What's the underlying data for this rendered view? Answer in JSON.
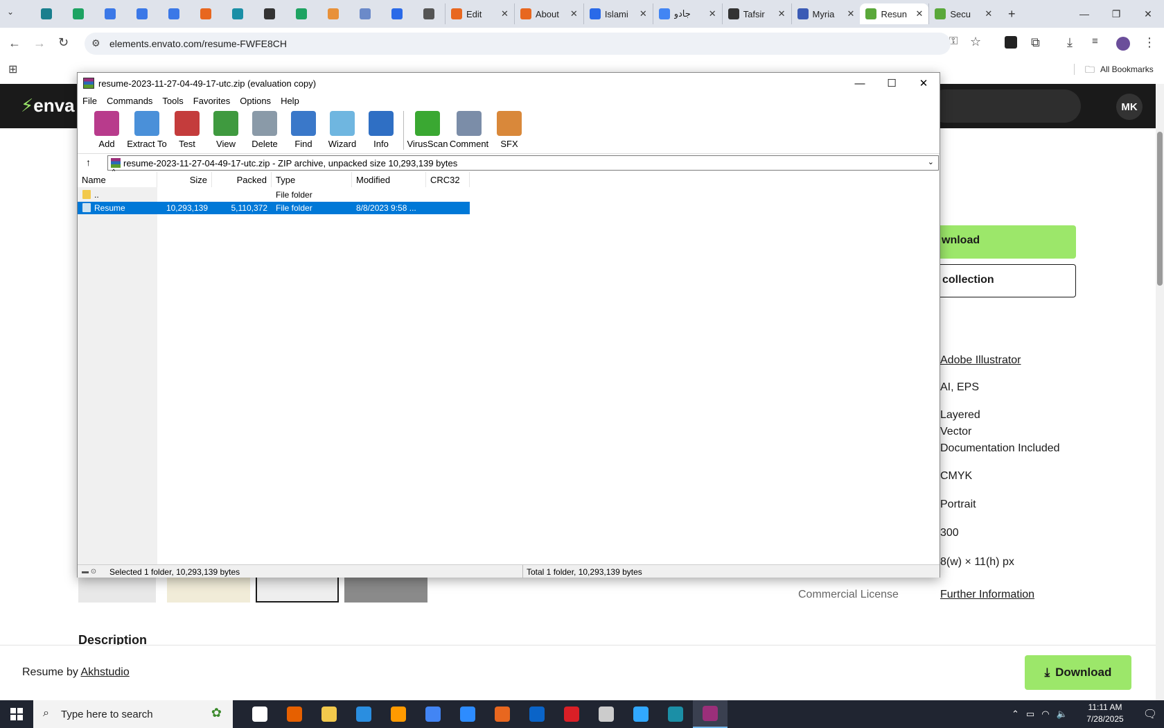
{
  "browser": {
    "pinned_tabs": [
      {
        "icon": "wordpress-icon",
        "color": "#1a7f8e"
      },
      {
        "icon": "sheets-icon",
        "color": "#1ea362"
      },
      {
        "icon": "docs-icon",
        "color": "#3b78e7"
      },
      {
        "icon": "docs-icon",
        "color": "#3b78e7"
      },
      {
        "icon": "docs-icon",
        "color": "#3b78e7"
      },
      {
        "icon": "envato-market-icon",
        "color": "#e8671f"
      },
      {
        "icon": "teal-app-icon",
        "color": "#1b8fa6"
      },
      {
        "icon": "openai-icon",
        "color": "#333333"
      },
      {
        "icon": "sheets-icon",
        "color": "#1ea362"
      },
      {
        "icon": "hand-icon",
        "color": "#e8913a"
      },
      {
        "icon": "grid-app-icon",
        "color": "#6b8ac9"
      },
      {
        "icon": "forms-icon",
        "color": "#2a6ae8"
      },
      {
        "icon": "speaker-icon",
        "color": "#555555"
      }
    ],
    "tabs": [
      {
        "title": "Edit",
        "icon": "envato-market-icon",
        "color": "#e8671f"
      },
      {
        "title": "About",
        "icon": "envato-market-icon",
        "color": "#e8671f"
      },
      {
        "title": "Islami",
        "icon": "docs-icon",
        "color": "#2a6ae8"
      },
      {
        "title": "جادو",
        "icon": "google-icon",
        "color": "#4285f4"
      },
      {
        "title": "Tafsir",
        "icon": "dark-app-icon",
        "color": "#333333"
      },
      {
        "title": "Myria",
        "icon": "myriad-icon",
        "color": "#3b5bb5"
      },
      {
        "title": "Resun",
        "icon": "envato-leaf-icon",
        "color": "#5aa83a",
        "active": true
      },
      {
        "title": "Secu",
        "icon": "envato-leaf-icon",
        "color": "#5aa83a"
      }
    ],
    "new_tab": "+",
    "url": "elements.envato.com/resume-FWFE8CH",
    "all_bookmarks": "All Bookmarks"
  },
  "envato": {
    "logo": "enva",
    "avatar": "MK",
    "download_label": "wnload",
    "collection_label": "collection",
    "attributes": [
      {
        "text": "Adobe Illustrator",
        "link": true
      },
      {
        "text": "AI, EPS",
        "link": false
      },
      {
        "text": "Layered",
        "link": false
      },
      {
        "text": "Vector",
        "link": false
      },
      {
        "text": "Documentation Included",
        "link": false
      },
      {
        "text": "CMYK",
        "link": false
      },
      {
        "text": "Portrait",
        "link": false
      },
      {
        "text": "300",
        "link": false
      },
      {
        "text": "8(w) × 11(h) px",
        "link": false
      }
    ],
    "commercial_license": "Commercial License",
    "further_info": "Further Information",
    "description": "Description",
    "by_prefix": "Resume by",
    "author": "Akhstudio",
    "bottom_download": "Download"
  },
  "winrar": {
    "title": "resume-2023-11-27-04-49-17-utc.zip (evaluation copy)",
    "menu": [
      "File",
      "Commands",
      "Tools",
      "Favorites",
      "Options",
      "Help"
    ],
    "toolbar": [
      {
        "label": "Add",
        "icon": "add-archive-icon",
        "color": "#b83b8c"
      },
      {
        "label": "Extract To",
        "icon": "extract-folder-icon",
        "color": "#4a90d9"
      },
      {
        "label": "Test",
        "icon": "test-clipboard-icon",
        "color": "#c43c3c"
      },
      {
        "label": "View",
        "icon": "view-book-icon",
        "color": "#3f9a3f"
      },
      {
        "label": "Delete",
        "icon": "trash-icon",
        "color": "#8a9aa8"
      },
      {
        "label": "Find",
        "icon": "magnifier-icon",
        "color": "#3a78c9"
      },
      {
        "label": "Wizard",
        "icon": "magic-wand-icon",
        "color": "#6fb6e0"
      },
      {
        "label": "Info",
        "icon": "info-icon",
        "color": "#2f6fc4"
      },
      {
        "label": "VirusScan",
        "icon": "virus-scan-icon",
        "color": "#3aa832"
      },
      {
        "label": "Comment",
        "icon": "comment-icon",
        "color": "#7b8da8"
      },
      {
        "label": "SFX",
        "icon": "sfx-box-icon",
        "color": "#d9883a"
      }
    ],
    "path": "resume-2023-11-27-04-49-17-utc.zip - ZIP archive, unpacked size 10,293,139 bytes",
    "columns": [
      "Name",
      "Size",
      "Packed",
      "Type",
      "Modified",
      "CRC32"
    ],
    "rows": [
      {
        "name": "..",
        "size": "",
        "packed": "",
        "type": "File folder",
        "modified": "",
        "crc": ""
      },
      {
        "name": "Resume",
        "size": "10,293,139",
        "packed": "5,110,372",
        "type": "File folder",
        "modified": "8/8/2023 9:58 ...",
        "crc": "",
        "selected": true
      }
    ],
    "status_left": "Selected 1 folder, 10,293,139 bytes",
    "status_right": "Total 1 folder, 10,293,139 bytes"
  },
  "taskbar": {
    "search_placeholder": "Type here to search",
    "apps": [
      {
        "icon": "task-view-icon",
        "color": "#ffffff"
      },
      {
        "icon": "firefox-icon",
        "color": "#e66000"
      },
      {
        "icon": "file-explorer-icon",
        "color": "#f2c94c"
      },
      {
        "icon": "vscode-icon",
        "color": "#2a8ee0"
      },
      {
        "icon": "illustrator-icon",
        "color": "#ff9a00"
      },
      {
        "icon": "chrome-icon",
        "color": "#4285f4"
      },
      {
        "icon": "zoom-icon",
        "color": "#2d8cff"
      },
      {
        "icon": "envato-market-icon",
        "color": "#e8671f"
      },
      {
        "icon": "outlook-icon",
        "color": "#0a64c8"
      },
      {
        "icon": "creative-cloud-icon",
        "color": "#da1f26"
      },
      {
        "icon": "pen-tool-icon",
        "color": "#cccccc"
      },
      {
        "icon": "photoshop-icon",
        "color": "#31a8ff"
      },
      {
        "icon": "teal-app-icon",
        "color": "#1b8fa6"
      },
      {
        "icon": "winrar-icon",
        "color": "#9b2f7a",
        "active": true
      }
    ],
    "time": "11:11 AM",
    "date": "7/28/2025"
  }
}
